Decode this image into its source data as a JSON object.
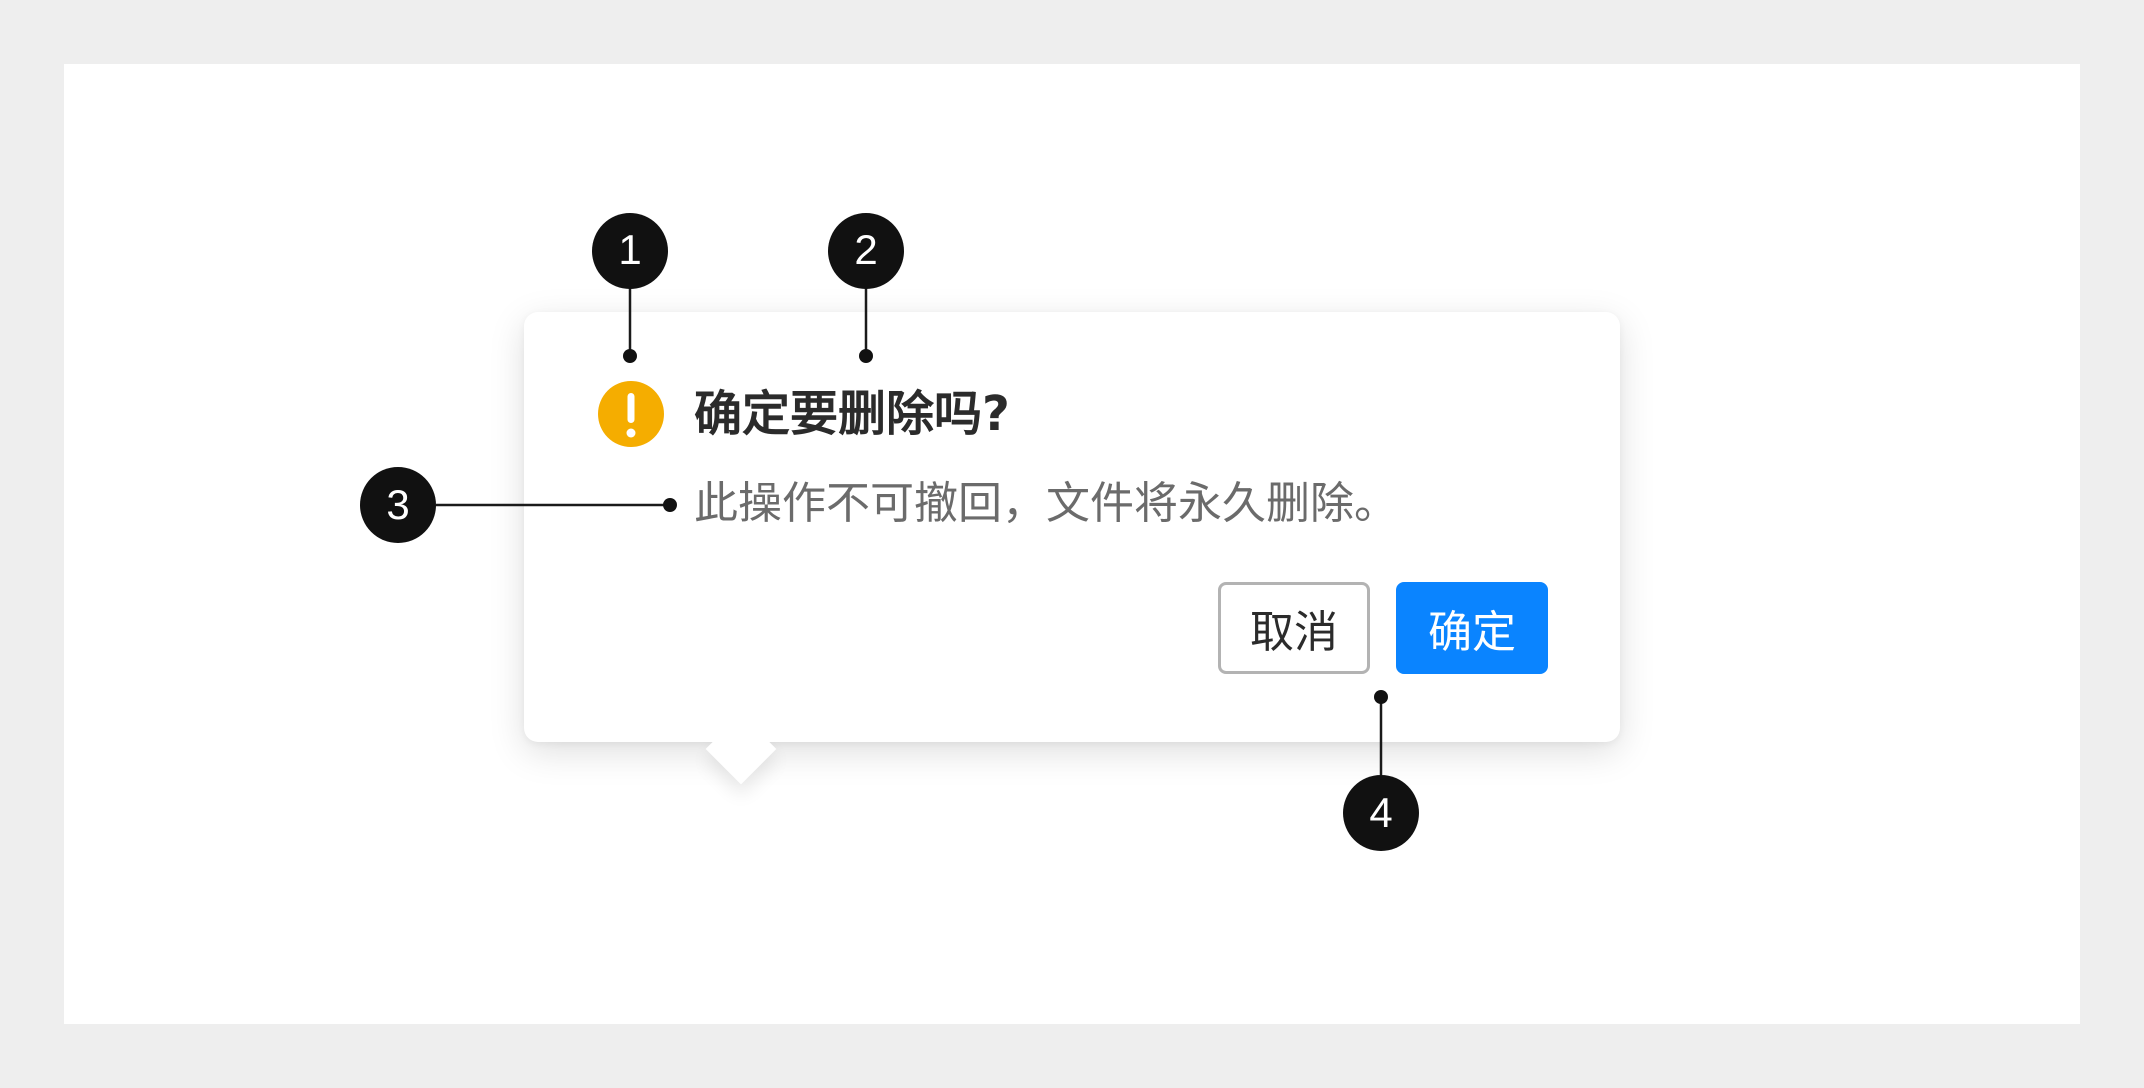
{
  "popconfirm": {
    "icon": "warning-icon",
    "title": "确定要删除吗?",
    "description": "此操作不可撤回，文件将永久删除。",
    "cancel_label": "取消",
    "confirm_label": "确定"
  },
  "callouts": [
    "1",
    "2",
    "3",
    "4"
  ],
  "colors": {
    "page_background": "#eeeeee",
    "canvas": "#ffffff",
    "warning": "#f5ad00",
    "primary": "#0a84ff",
    "callout": "#111111"
  }
}
